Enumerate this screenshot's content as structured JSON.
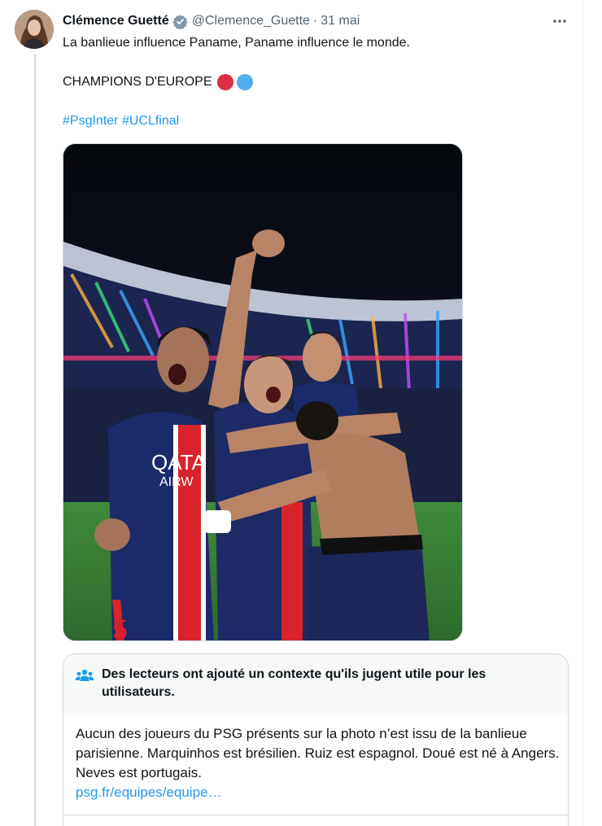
{
  "tweet": {
    "author_name": "Clémence Guetté",
    "handle": "@Clemence_Guette",
    "separator": "·",
    "date": "31 mai",
    "line1": "La banlieue influence Paname, Paname influence le monde.",
    "line2": "CHAMPIONS D'EUROPE",
    "emoji_colors": [
      "#dd2e44",
      "#55acee"
    ],
    "hashtags": [
      "#PsgInter",
      "#UCLfinal"
    ],
    "accent_color": "#1d9bf0",
    "more_icon": "more-horizontal-icon",
    "verified_icon": "verified-badge-icon"
  },
  "community_note": {
    "title": "Des lecteurs ont ajouté un contexte qu'ils jugent utile pour les utilisateurs.",
    "body": "Aucun des joueurs du PSG présents sur la photo n’est issu de la banlieue parisienne. Marquinhos est brésilien. Ruiz est espagnol. Doué est né à Angers. Neves est portugais.",
    "link": "psg.fr/equipes/equipe…",
    "icon": "people-icon"
  },
  "photo": {
    "jersey_sponsor": "QATAR AIRWAYS",
    "shirt_number": "5"
  }
}
